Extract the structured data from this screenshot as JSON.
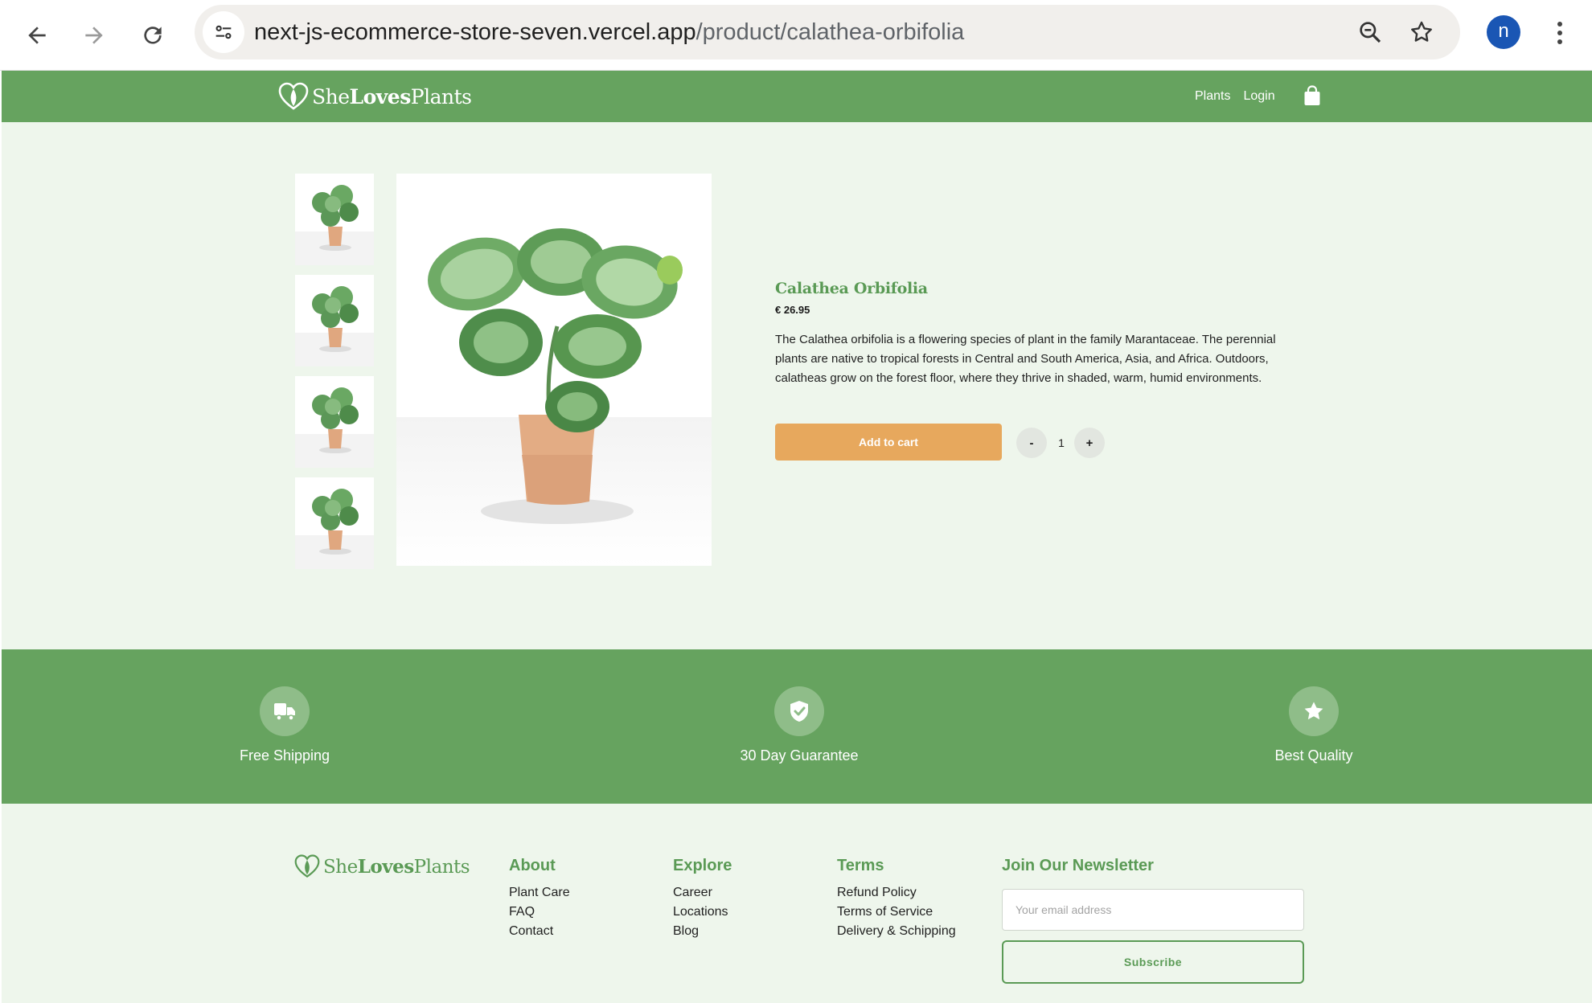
{
  "browser": {
    "url_host": "next-js-ecommerce-store-seven.vercel.app",
    "url_path": "/product/calathea-orbifolia",
    "profile_initial": "n",
    "icons": [
      "back-icon",
      "forward-icon",
      "reload-icon",
      "site-info-icon",
      "zoom-icon",
      "bookmark-star-icon",
      "more-vert-icon"
    ]
  },
  "header": {
    "logo": {
      "part1": "She",
      "part2": "Loves",
      "part3": "Plants"
    },
    "nav": [
      {
        "label": "Plants"
      },
      {
        "label": "Login"
      }
    ],
    "cart_icon": "shopping-bag-icon"
  },
  "product": {
    "name": "Calathea Orbifolia",
    "price": "€ 26.95",
    "description": "The Calathea orbifolia is a flowering species of plant in the family Marantaceae. The perennial plants are native to tropical forests in Central and South America, Asia, and Africa. Outdoors, calatheas grow on the forest floor, where they thrive in shaded, warm, humid environments.",
    "add_to_cart_label": "Add to cart",
    "decrement_label": "-",
    "increment_label": "+",
    "quantity": "1",
    "thumbnail_count": 4
  },
  "features": [
    {
      "label": "Free Shipping",
      "icon": "truck-icon"
    },
    {
      "label": "30 Day Guarantee",
      "icon": "shield-check-icon"
    },
    {
      "label": "Best Quality",
      "icon": "star-icon"
    }
  ],
  "footer": {
    "logo": {
      "part1": "She",
      "part2": "Loves",
      "part3": "Plants"
    },
    "columns": [
      {
        "title": "About",
        "links": [
          "Plant Care",
          "FAQ",
          "Contact"
        ]
      },
      {
        "title": "Explore",
        "links": [
          "Career",
          "Locations",
          "Blog"
        ]
      },
      {
        "title": "Terms",
        "links": [
          "Refund Policy",
          "Terms of Service",
          "Delivery & Schipping"
        ]
      }
    ],
    "newsletter": {
      "title": "Join Our Newsletter",
      "placeholder": "Your email address",
      "button_label": "Subscribe"
    }
  },
  "colors": {
    "brand_green": "#66a35f",
    "text_green": "#5a9a55",
    "page_background": "#eef6ec",
    "accent_orange": "#e7a85d"
  }
}
